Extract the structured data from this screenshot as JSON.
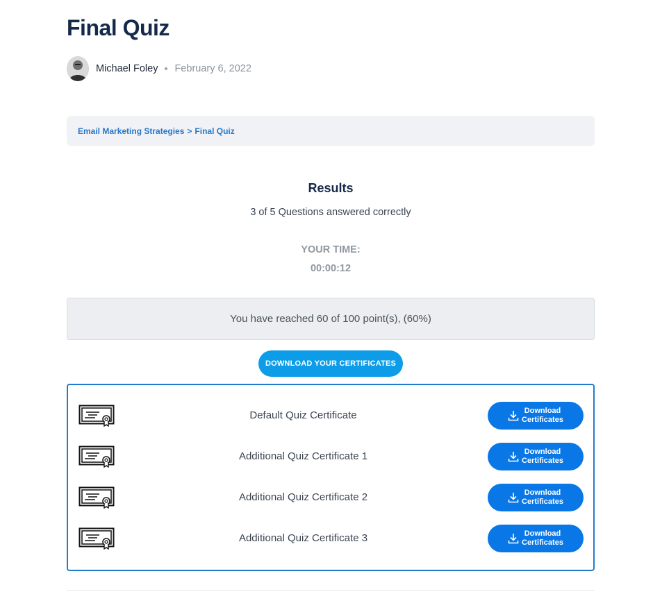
{
  "page": {
    "title": "Final Quiz"
  },
  "meta": {
    "author": "Michael Foley",
    "date": "February 6, 2022"
  },
  "breadcrumb": {
    "course": "Email Marketing Strategies",
    "separator": ">",
    "current": "Final Quiz"
  },
  "results": {
    "title": "Results",
    "summary": "3 of 5 Questions answered correctly",
    "time_label": "YOUR TIME:",
    "time_value": "00:00:12",
    "points_message": "You have reached 60 of 100 point(s), (60%)"
  },
  "certificates": {
    "toggle_label": "DOWNLOAD YOUR CERTIFICATES",
    "items": [
      {
        "name": "Default Quiz Certificate",
        "button_line1": "Download",
        "button_line2": "Certificates"
      },
      {
        "name": "Additional Quiz Certificate 1",
        "button_line1": "Download",
        "button_line2": "Certificates"
      },
      {
        "name": "Additional Quiz Certificate 2",
        "button_line1": "Download",
        "button_line2": "Certificates"
      },
      {
        "name": "Additional Quiz Certificate 3",
        "button_line1": "Download",
        "button_line2": "Certificates"
      }
    ]
  },
  "colors": {
    "title": "#15294a",
    "link": "#2a78c9",
    "toggle_button": "#0d9de8",
    "download_button": "#0a77e6",
    "panel_border": "#1f7ccd"
  },
  "icons": {
    "certificate": "certificate-icon",
    "download": "download-icon"
  }
}
